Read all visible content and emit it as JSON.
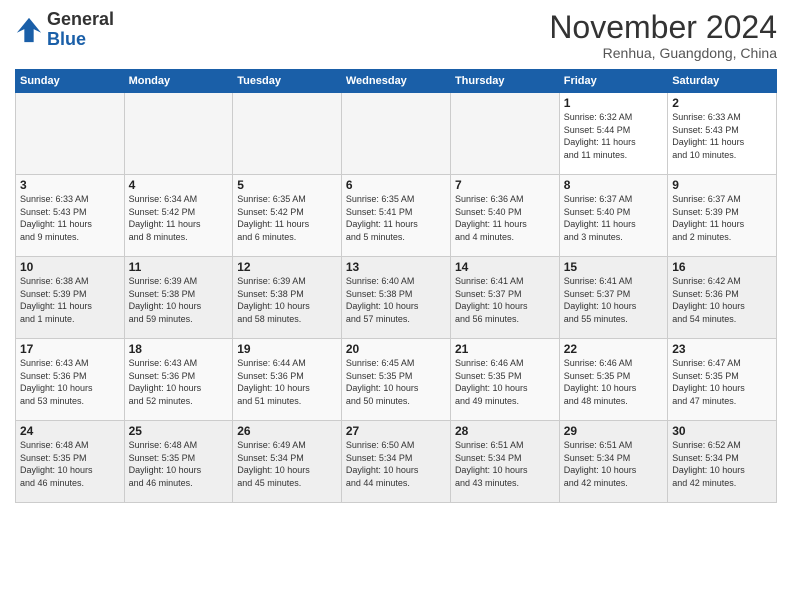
{
  "header": {
    "logo_line1": "General",
    "logo_line2": "Blue",
    "month_title": "November 2024",
    "subtitle": "Renhua, Guangdong, China"
  },
  "weekdays": [
    "Sunday",
    "Monday",
    "Tuesday",
    "Wednesday",
    "Thursday",
    "Friday",
    "Saturday"
  ],
  "weeks": [
    [
      {
        "day": "",
        "info": ""
      },
      {
        "day": "",
        "info": ""
      },
      {
        "day": "",
        "info": ""
      },
      {
        "day": "",
        "info": ""
      },
      {
        "day": "",
        "info": ""
      },
      {
        "day": "1",
        "info": "Sunrise: 6:32 AM\nSunset: 5:44 PM\nDaylight: 11 hours\nand 11 minutes."
      },
      {
        "day": "2",
        "info": "Sunrise: 6:33 AM\nSunset: 5:43 PM\nDaylight: 11 hours\nand 10 minutes."
      }
    ],
    [
      {
        "day": "3",
        "info": "Sunrise: 6:33 AM\nSunset: 5:43 PM\nDaylight: 11 hours\nand 9 minutes."
      },
      {
        "day": "4",
        "info": "Sunrise: 6:34 AM\nSunset: 5:42 PM\nDaylight: 11 hours\nand 8 minutes."
      },
      {
        "day": "5",
        "info": "Sunrise: 6:35 AM\nSunset: 5:42 PM\nDaylight: 11 hours\nand 6 minutes."
      },
      {
        "day": "6",
        "info": "Sunrise: 6:35 AM\nSunset: 5:41 PM\nDaylight: 11 hours\nand 5 minutes."
      },
      {
        "day": "7",
        "info": "Sunrise: 6:36 AM\nSunset: 5:40 PM\nDaylight: 11 hours\nand 4 minutes."
      },
      {
        "day": "8",
        "info": "Sunrise: 6:37 AM\nSunset: 5:40 PM\nDaylight: 11 hours\nand 3 minutes."
      },
      {
        "day": "9",
        "info": "Sunrise: 6:37 AM\nSunset: 5:39 PM\nDaylight: 11 hours\nand 2 minutes."
      }
    ],
    [
      {
        "day": "10",
        "info": "Sunrise: 6:38 AM\nSunset: 5:39 PM\nDaylight: 11 hours\nand 1 minute."
      },
      {
        "day": "11",
        "info": "Sunrise: 6:39 AM\nSunset: 5:38 PM\nDaylight: 10 hours\nand 59 minutes."
      },
      {
        "day": "12",
        "info": "Sunrise: 6:39 AM\nSunset: 5:38 PM\nDaylight: 10 hours\nand 58 minutes."
      },
      {
        "day": "13",
        "info": "Sunrise: 6:40 AM\nSunset: 5:38 PM\nDaylight: 10 hours\nand 57 minutes."
      },
      {
        "day": "14",
        "info": "Sunrise: 6:41 AM\nSunset: 5:37 PM\nDaylight: 10 hours\nand 56 minutes."
      },
      {
        "day": "15",
        "info": "Sunrise: 6:41 AM\nSunset: 5:37 PM\nDaylight: 10 hours\nand 55 minutes."
      },
      {
        "day": "16",
        "info": "Sunrise: 6:42 AM\nSunset: 5:36 PM\nDaylight: 10 hours\nand 54 minutes."
      }
    ],
    [
      {
        "day": "17",
        "info": "Sunrise: 6:43 AM\nSunset: 5:36 PM\nDaylight: 10 hours\nand 53 minutes."
      },
      {
        "day": "18",
        "info": "Sunrise: 6:43 AM\nSunset: 5:36 PM\nDaylight: 10 hours\nand 52 minutes."
      },
      {
        "day": "19",
        "info": "Sunrise: 6:44 AM\nSunset: 5:36 PM\nDaylight: 10 hours\nand 51 minutes."
      },
      {
        "day": "20",
        "info": "Sunrise: 6:45 AM\nSunset: 5:35 PM\nDaylight: 10 hours\nand 50 minutes."
      },
      {
        "day": "21",
        "info": "Sunrise: 6:46 AM\nSunset: 5:35 PM\nDaylight: 10 hours\nand 49 minutes."
      },
      {
        "day": "22",
        "info": "Sunrise: 6:46 AM\nSunset: 5:35 PM\nDaylight: 10 hours\nand 48 minutes."
      },
      {
        "day": "23",
        "info": "Sunrise: 6:47 AM\nSunset: 5:35 PM\nDaylight: 10 hours\nand 47 minutes."
      }
    ],
    [
      {
        "day": "24",
        "info": "Sunrise: 6:48 AM\nSunset: 5:35 PM\nDaylight: 10 hours\nand 46 minutes."
      },
      {
        "day": "25",
        "info": "Sunrise: 6:48 AM\nSunset: 5:35 PM\nDaylight: 10 hours\nand 46 minutes."
      },
      {
        "day": "26",
        "info": "Sunrise: 6:49 AM\nSunset: 5:34 PM\nDaylight: 10 hours\nand 45 minutes."
      },
      {
        "day": "27",
        "info": "Sunrise: 6:50 AM\nSunset: 5:34 PM\nDaylight: 10 hours\nand 44 minutes."
      },
      {
        "day": "28",
        "info": "Sunrise: 6:51 AM\nSunset: 5:34 PM\nDaylight: 10 hours\nand 43 minutes."
      },
      {
        "day": "29",
        "info": "Sunrise: 6:51 AM\nSunset: 5:34 PM\nDaylight: 10 hours\nand 42 minutes."
      },
      {
        "day": "30",
        "info": "Sunrise: 6:52 AM\nSunset: 5:34 PM\nDaylight: 10 hours\nand 42 minutes."
      }
    ]
  ]
}
